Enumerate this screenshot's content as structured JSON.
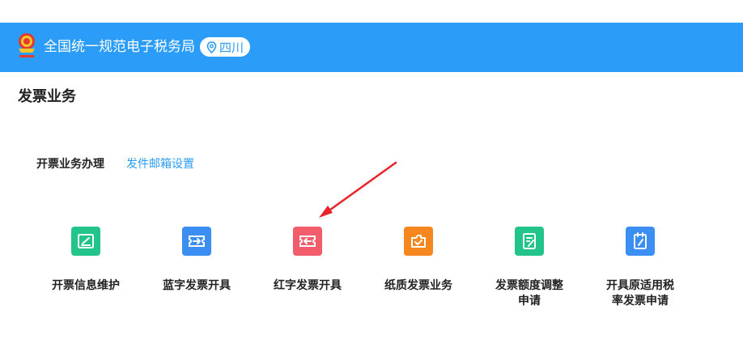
{
  "header": {
    "site_title": "全国统一规范电子税务局",
    "region": "四川"
  },
  "page": {
    "title": "发票业务"
  },
  "section": {
    "label": "开票业务办理",
    "link": "发件邮箱设置"
  },
  "tiles": [
    {
      "label_line1": "开票信息维护",
      "label_line2": "",
      "icon": "edit-box-icon",
      "color": "#23c489"
    },
    {
      "label_line1": "蓝字发票开具",
      "label_line2": "",
      "icon": "blue-invoice-icon",
      "color": "#3b8ff3"
    },
    {
      "label_line1": "红字发票开具",
      "label_line2": "",
      "icon": "red-invoice-icon",
      "color": "#f25c6b"
    },
    {
      "label_line1": "纸质发票业务",
      "label_line2": "",
      "icon": "paper-invoice-icon",
      "color": "#f6871f"
    },
    {
      "label_line1": "发票额度调整",
      "label_line2": "申请",
      "icon": "quota-adjust-icon",
      "color": "#23c489"
    },
    {
      "label_line1": "开具原适用税",
      "label_line2": "率发票申请",
      "icon": "tax-rate-icon",
      "color": "#3b8ff3"
    }
  ],
  "colors": {
    "header_bg": "#2b9cf7",
    "link": "#2b9cf7",
    "annotation_arrow": "#e8232b"
  }
}
